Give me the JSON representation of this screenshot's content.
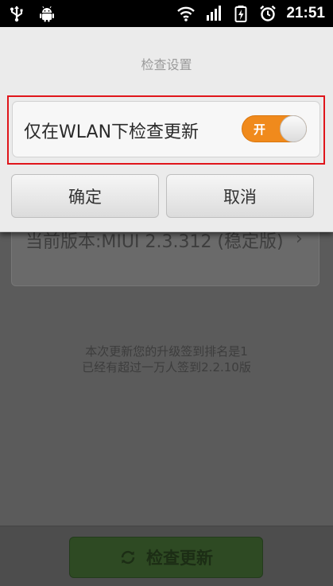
{
  "status_bar": {
    "time": "21:51",
    "left_icons": [
      "usb-icon",
      "android-icon"
    ],
    "right_icons": [
      "wifi-icon",
      "signal-icon",
      "battery-charging-icon",
      "alarm-icon"
    ]
  },
  "dialog": {
    "title": "检查设置",
    "option": {
      "label": "仅在WLAN下检查更新",
      "toggle_text": "开",
      "toggle_on": true,
      "accent_color": "#f08a1c"
    },
    "buttons": {
      "confirm": "确定",
      "cancel": "取消"
    },
    "highlight_color": "#e0151b"
  },
  "background_page": {
    "version_text": "当前版本:MIUI 2.3.312 (稳定版)",
    "info_lines": [
      "本次更新您的升级签到排名是1",
      "已经有超过一万人签到2.2.10版"
    ],
    "check_button": "检查更新",
    "check_button_color": "#2e4a23"
  }
}
